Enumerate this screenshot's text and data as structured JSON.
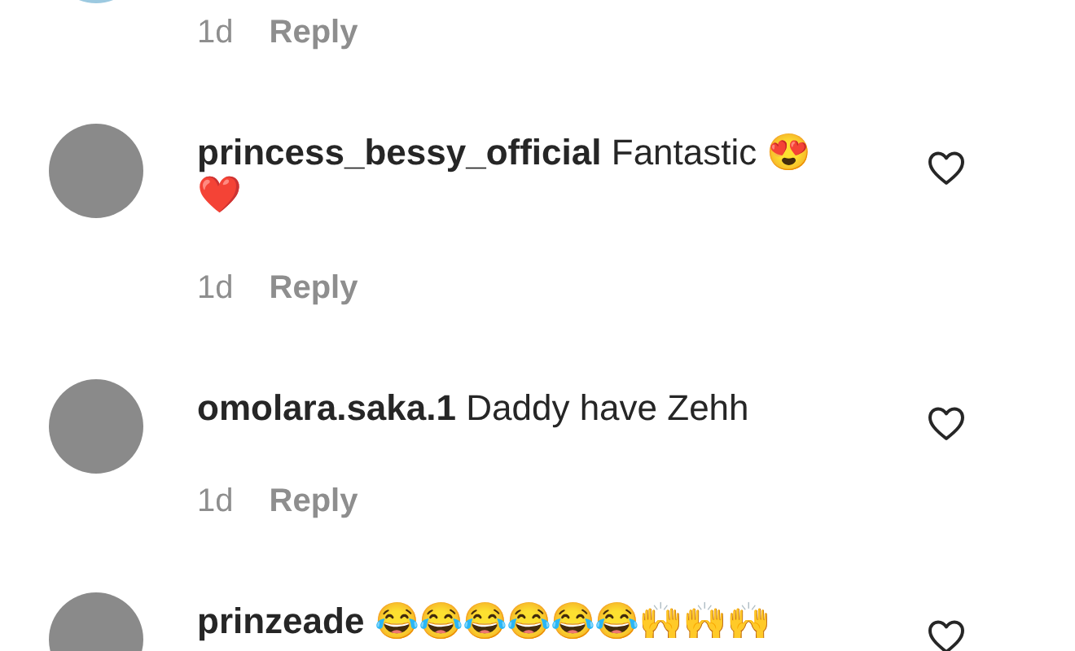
{
  "comments": [
    {
      "time": "1d",
      "reply_label": "Reply"
    },
    {
      "username": "princess_bessy_official",
      "text": "Fantastic 😍❤️",
      "time": "1d",
      "reply_label": "Reply",
      "liked": false
    },
    {
      "username": "omolara.saka.1",
      "text": "Daddy have Zehh",
      "time": "1d",
      "reply_label": "Reply",
      "liked": false
    },
    {
      "username": "prinzeade",
      "text": "😂😂😂😂😂😂🙌🙌🙌",
      "liked": false
    }
  ]
}
